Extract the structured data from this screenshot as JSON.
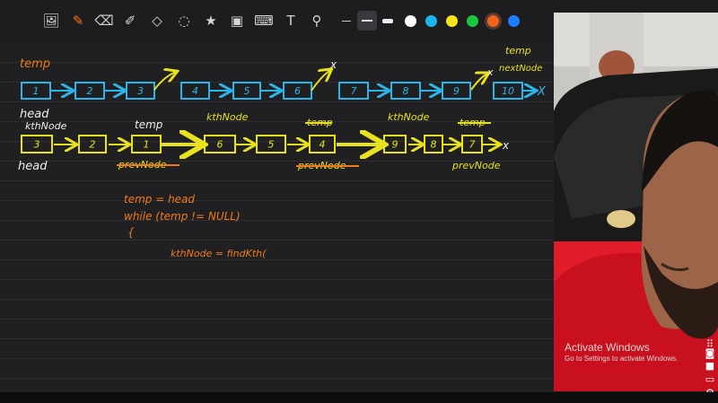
{
  "toolbar": {
    "tools": [
      {
        "icon": "image-search-icon",
        "glyph": "🖼"
      },
      {
        "icon": "pen-icon",
        "glyph": "✎"
      },
      {
        "icon": "eraser-icon",
        "glyph": "⌫"
      },
      {
        "icon": "highlighter-icon",
        "glyph": "✐"
      },
      {
        "icon": "shapes-icon",
        "glyph": "◇"
      },
      {
        "icon": "lasso-icon",
        "glyph": "◌"
      },
      {
        "icon": "stamp-icon",
        "glyph": "★"
      },
      {
        "icon": "image-icon",
        "glyph": "▣"
      },
      {
        "icon": "keyboard-icon",
        "glyph": "⌨"
      },
      {
        "icon": "text-icon",
        "glyph": "T"
      },
      {
        "icon": "laser-pointer-icon",
        "glyph": "⚲"
      }
    ],
    "stroke_sizes": [
      "thin",
      "medium",
      "thick"
    ],
    "selected_stroke": "medium",
    "colors": [
      "#ffffff",
      "#1ab4f0",
      "#f5e61c",
      "#19c83c",
      "#f2641c",
      "#1f7cff"
    ],
    "selected_color": "#f2641c"
  },
  "colors": {
    "blue_ink": "#2bb5e8",
    "yellow_ink": "#e8e11e",
    "orange_ink": "#f07a1c",
    "white_ink": "#eeeeee"
  },
  "whiteboard": {
    "row1": {
      "label_temp_left": "temp",
      "label_temp_right": "temp",
      "nodes": [
        "1",
        "2",
        "3",
        "4",
        "5",
        "6",
        "7",
        "8",
        "9",
        "10"
      ],
      "head_label": "head",
      "next_node_label": "nextNode",
      "x_marks": [
        "x",
        "x",
        "X"
      ]
    },
    "row2": {
      "kth_labels": [
        "kthNode",
        "kthNode",
        "kthNode"
      ],
      "temp_labels": [
        "temp",
        "temp",
        "temp"
      ],
      "nodes": [
        "3",
        "2",
        "1",
        "6",
        "5",
        "4",
        "9",
        "8",
        "7"
      ],
      "head_label": "head",
      "prev_labels": [
        "prevNode",
        "prevNode",
        "prevNode"
      ],
      "x_mark": "x"
    },
    "code": [
      "temp = head",
      "while (temp != NULL)",
      "{",
      "kthNode = findKth("
    ]
  },
  "watermark": {
    "title": "Activate Windows",
    "subtitle": "Go to Settings to activate Windows."
  },
  "side_icons": [
    "grid-icon",
    "camera-icon",
    "video-icon",
    "window-icon",
    "settings-icon"
  ]
}
